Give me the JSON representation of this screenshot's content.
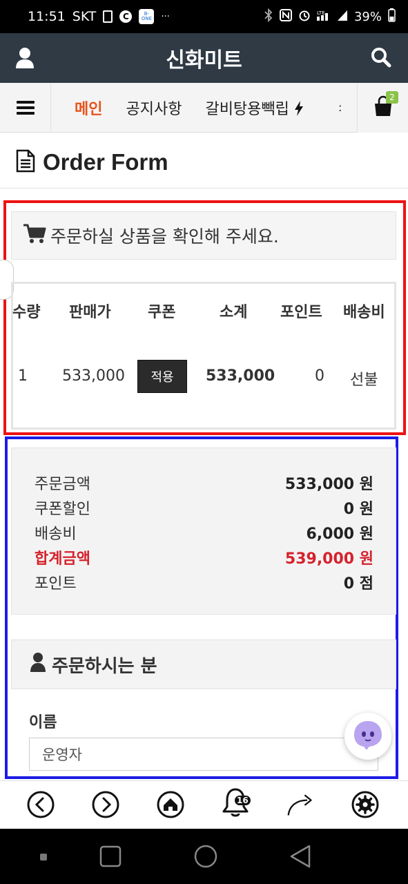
{
  "status_bar": {
    "time": "11:51",
    "carrier": "SKT",
    "app_icon_text": "B-ONE",
    "more": "···",
    "network": "LTE",
    "battery": "39%"
  },
  "header": {
    "title": "신화미트"
  },
  "nav": {
    "items": [
      "메인",
      "공지사항",
      "갈비탕용빽립"
    ],
    "more": ":",
    "cart_count": "2"
  },
  "page": {
    "title": "Order Form"
  },
  "order_items": {
    "heading": "주문하실 상품을 확인해 주세요.",
    "columns": [
      "수량",
      "판매가",
      "쿠폰",
      "소계",
      "포인트",
      "배송비"
    ],
    "rows": [
      {
        "qty": "1",
        "price": "533,000",
        "coupon_button": "적용",
        "subtotal": "533,000",
        "points": "0",
        "shipping": "선불"
      }
    ]
  },
  "summary": {
    "rows": [
      {
        "label": "주문금액",
        "value": "533,000 원"
      },
      {
        "label": "쿠폰할인",
        "value": "0 원"
      },
      {
        "label": "배송비",
        "value": "6,000 원"
      },
      {
        "label": "합계금액",
        "value": "539,000 원"
      },
      {
        "label": "포인트",
        "value": "0 점"
      }
    ],
    "total_color": "#d5222d"
  },
  "orderer": {
    "heading": "주문하시는 분",
    "name_label": "이름",
    "name_value": "운영자"
  },
  "toolbar": {
    "bell_count": "16"
  },
  "colors": {
    "header_bg": "#2f3a45",
    "nav_active": "#e8531a",
    "highlight_red": "#e11111",
    "highlight_blue": "#1c1ce6"
  }
}
